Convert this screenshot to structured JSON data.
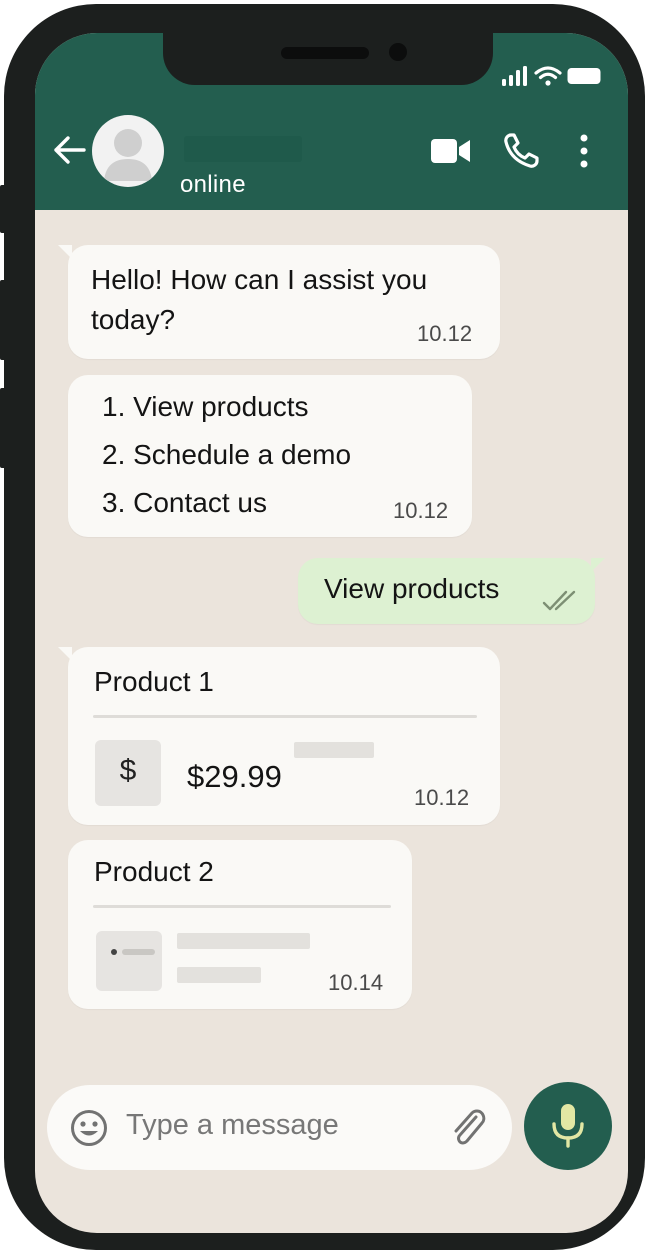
{
  "header": {
    "status": "online",
    "colors": {
      "header": "#235e4f",
      "chat_bg": "#ebe4dc"
    }
  },
  "messages": [
    {
      "direction": "incoming",
      "text_line1": "Hello! How can I assist you",
      "text_line2": "today?",
      "time": "10.12"
    },
    {
      "direction": "incoming",
      "options": [
        "1. View products",
        "2. Schedule a demo",
        "3. Contact us"
      ],
      "time": "10.12"
    },
    {
      "direction": "outgoing",
      "text": "View products",
      "time_icon": "double-check-icon"
    },
    {
      "direction": "incoming",
      "title": "Product 1",
      "icon": "$",
      "price": "$29.99",
      "time": "10.12"
    },
    {
      "direction": "incoming",
      "title": "Product 2",
      "time": "10.14"
    }
  ],
  "composer": {
    "placeholder": "Type a message",
    "icons": [
      "emoji-icon",
      "attach-icon",
      "mic-icon"
    ]
  }
}
